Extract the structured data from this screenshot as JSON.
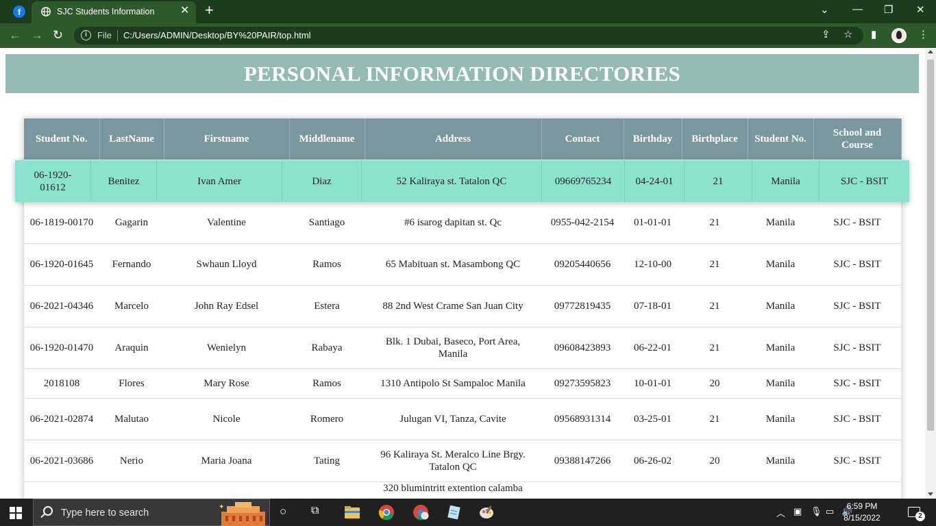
{
  "browser": {
    "tab_title": "SJC Students Information",
    "file_label": "File",
    "url": "C:/Users/ADMIN/Desktop/BY%20PAIR/top.html"
  },
  "page": {
    "banner_title": "PERSONAL INFORMATION DIRECTORIES",
    "columns": [
      "Student No.",
      "LastName",
      "Firstname",
      "Middlename",
      "Address",
      "Contact",
      "Birthday",
      "Birthplace",
      "Student No.",
      "School and Course"
    ],
    "highlighted_row": [
      "06-1920-01612",
      "Benitez",
      "Ivan Amer",
      "Diaz",
      "52 Kaliraya st. Tatalon QC",
      "09669765234",
      "04-24-01",
      "21",
      "Manila",
      "SJC - BSIT"
    ],
    "rows": [
      [
        "06-1819-00170",
        "Gagarin",
        "Valentine",
        "Santiago",
        "#6 isarog dapitan st. Qc",
        "0955-042-2154",
        "01-01-01",
        "21",
        "Manila",
        "SJC - BSIT"
      ],
      [
        "06-1920-01645",
        "Fernando",
        "Swhaun Lloyd",
        "Ramos",
        "65 Mabituan st. Masambong QC",
        "09205440656",
        "12-10-00",
        "21",
        "Manila",
        "SJC - BSIT"
      ],
      [
        "06-2021-04346",
        "Marcelo",
        "John Ray Edsel",
        "Estera",
        "88 2nd West Crame San Juan City",
        "09772819435",
        "07-18-01",
        "21",
        "Manila",
        "SJC - BSIT"
      ],
      [
        "06-1920-01470",
        "Araquin",
        "Wenielyn",
        "Rabaya",
        "Blk. 1 Dubai, Baseco, Port Area, Manila",
        "09608423893",
        "06-22-01",
        "21",
        "Manila",
        "SJC - BSIT"
      ],
      [
        "2018108",
        "Flores",
        "Mary Rose",
        "Ramos",
        "1310 Antipolo St Sampaloc Manila",
        "09273595823",
        "10-01-01",
        "20",
        "Manila",
        "SJC - BSIT"
      ],
      [
        "06-2021-02874",
        "Malutao",
        "Nicole",
        "Romero",
        "Julugan VI, Tanza, Cavite",
        "09568931314",
        "03-25-01",
        "21",
        "Manila",
        "SJC - BSIT"
      ],
      [
        "06-2021-03686",
        "Nerio",
        "Maria Joana",
        "Tating",
        "96 Kaliraya St. Meralco Line Brgy. Tatalon QC",
        "09388147266",
        "06-26-02",
        "20",
        "Manila",
        "SJC - BSIT"
      ],
      [
        "",
        "",
        "",
        "",
        "320 blumintritt extention calamba",
        "",
        "",
        "",
        "",
        ""
      ]
    ]
  },
  "taskbar": {
    "search_placeholder": "Type here to search",
    "time": "6:59 PM",
    "date": "8/15/2022",
    "notification_count": "2"
  }
}
